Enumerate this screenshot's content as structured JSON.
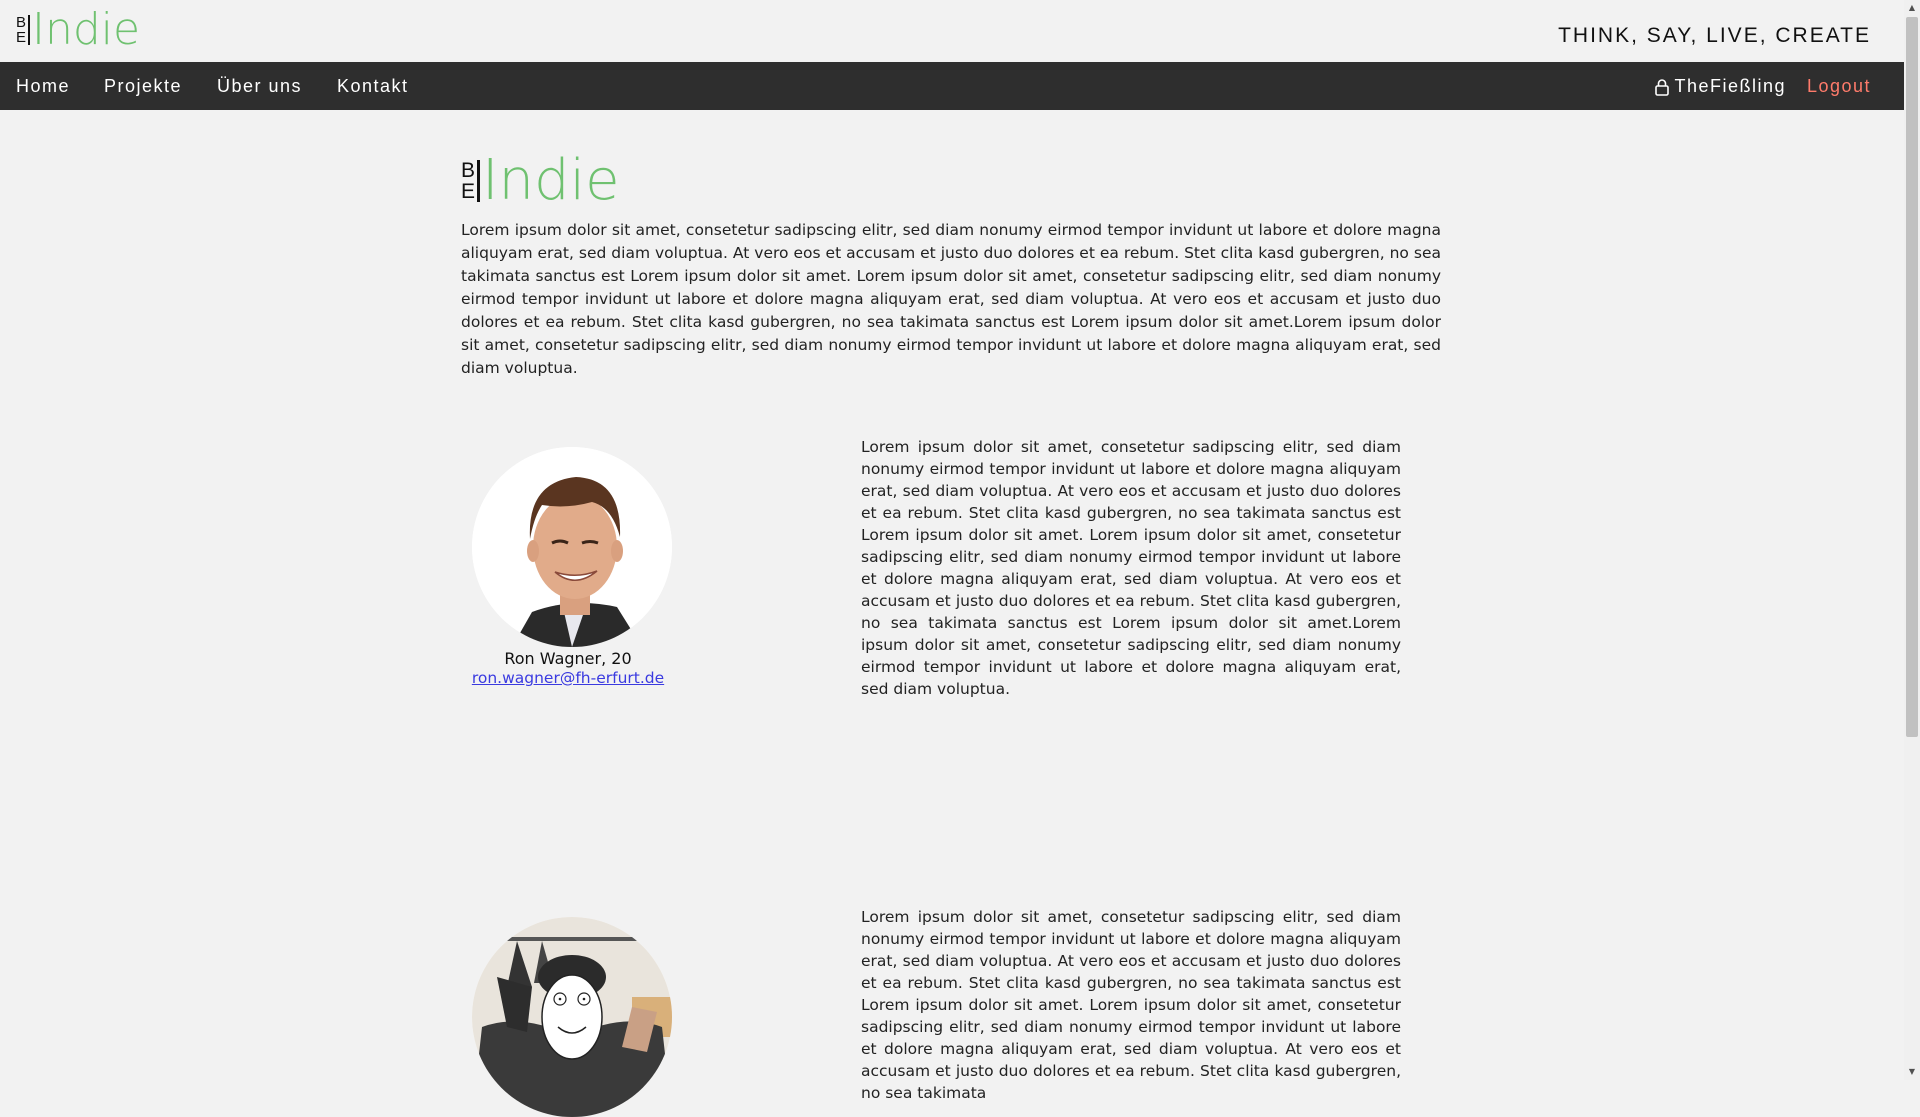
{
  "header": {
    "logo_be_top": "B",
    "logo_be_bottom": "E",
    "logo_word": "Indie",
    "tagline": "THINK, SAY, LIVE, CREATE"
  },
  "nav": {
    "items": [
      {
        "label": "Home"
      },
      {
        "label": "Projekte"
      },
      {
        "label": "Über uns"
      },
      {
        "label": "Kontakt"
      }
    ],
    "user": "TheFießling",
    "logout": "Logout"
  },
  "main": {
    "logo_word": "Indie",
    "intro": "Lorem ipsum dolor sit amet, consetetur sadipscing elitr, sed diam nonumy eirmod tempor invidunt ut labore et dolore magna aliquyam erat, sed diam voluptua. At vero eos et accusam et justo duo dolores et ea rebum. Stet clita kasd gubergren, no sea takimata sanctus est Lorem ipsum dolor sit amet. Lorem ipsum dolor sit amet, consetetur sadipscing elitr, sed diam nonumy eirmod tempor invidunt ut labore et dolore magna aliquyam erat, sed diam voluptua. At vero eos et accusam et justo duo dolores et ea rebum. Stet clita kasd gubergren, no sea takimata sanctus est Lorem ipsum dolor sit amet.Lorem ipsum dolor sit amet, consetetur sadipscing elitr, sed diam nonumy eirmod tempor invidunt ut labore et dolore magna aliquyam erat, sed diam voluptua.",
    "members": [
      {
        "name": "Ron Wagner, 20",
        "email": "ron.wagner@fh-erfurt.de",
        "bio": "Lorem ipsum dolor sit amet, consetetur sadipscing elitr, sed diam nonumy eirmod tempor invidunt ut labore et dolore magna aliquyam erat, sed diam voluptua. At vero eos et accusam et justo duo dolores et ea rebum. Stet clita kasd gubergren, no sea takimata sanctus est Lorem ipsum dolor sit amet. Lorem ipsum dolor sit amet, consetetur sadipscing elitr, sed diam nonumy eirmod tempor invidunt ut labore et dolore magna aliquyam erat, sed diam voluptua. At vero eos et accusam et justo duo dolores et ea rebum. Stet clita kasd gubergren, no sea takimata sanctus est Lorem ipsum dolor sit amet.Lorem ipsum dolor sit amet, consetetur sadipscing elitr, sed diam nonumy eirmod tempor invidunt ut labore et dolore magna aliquyam erat, sed diam voluptua."
      },
      {
        "bio": "Lorem ipsum dolor sit amet, consetetur sadipscing elitr, sed diam nonumy eirmod tempor invidunt ut labore et dolore magna aliquyam erat, sed diam voluptua. At vero eos et accusam et justo duo dolores et ea rebum. Stet clita kasd gubergren, no sea takimata sanctus est Lorem ipsum dolor sit amet. Lorem ipsum dolor sit amet, consetetur sadipscing elitr, sed diam nonumy eirmod tempor invidunt ut labore et dolore magna aliquyam erat, sed diam voluptua. At vero eos et accusam et justo duo dolores et ea rebum. Stet clita kasd gubergren, no sea takimata"
      }
    ]
  },
  "colors": {
    "accent_green": "#6fc170",
    "nav_bg": "#2e2e2e",
    "logout": "#ff7b6b",
    "link": "#3a3ae0"
  },
  "icons": {
    "user": "user-lock-icon",
    "scroll_up": "arrow-up-icon",
    "scroll_down": "arrow-down-icon"
  }
}
